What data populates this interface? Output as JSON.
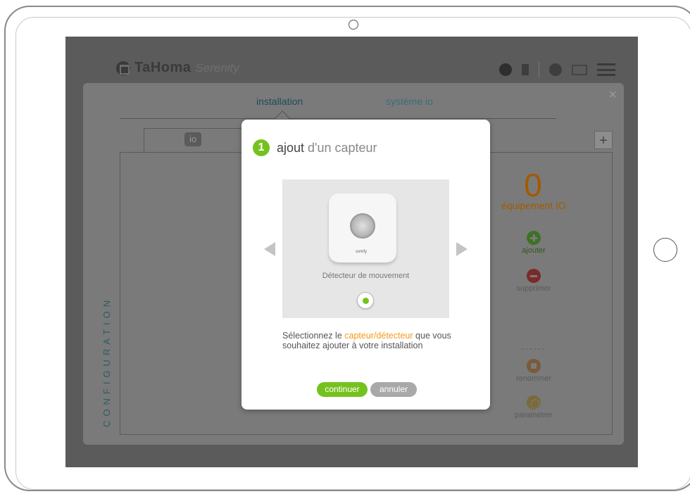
{
  "app": {
    "logo_text": "TaHoma",
    "logo_sub": "Serenity"
  },
  "header_icons": [
    "home-icon",
    "door-icon",
    "user-icon",
    "mail-icon",
    "menu-icon"
  ],
  "config": {
    "close_label": "×",
    "tab_installation": "installation",
    "tab_systeme": "système io",
    "subtab_io_label": "io",
    "add_tab_label": "+",
    "vertical_label": "CONFIGURATION",
    "count": "0",
    "count_label": "équipement IO",
    "actions": {
      "add": "ajouter",
      "delete": "supprimer",
      "separator": "------",
      "rename": "renommer",
      "settings": "paramétrer"
    }
  },
  "modal": {
    "step": "1",
    "title_strong": "ajout",
    "title_rest": " d'un capteur",
    "product_name": "Détecteur de mouvement",
    "product_brand": "somfy",
    "description_pre": "Sélectionnez le ",
    "description_highlight": "capteur/détecteur",
    "description_post": " que vous souhaitez ajouter à votre installation",
    "continue_label": "continuer",
    "cancel_label": "annuler"
  },
  "colors": {
    "accent_green": "#75c21e",
    "accent_orange": "#f39a1a",
    "teal": "#1e4c56"
  }
}
